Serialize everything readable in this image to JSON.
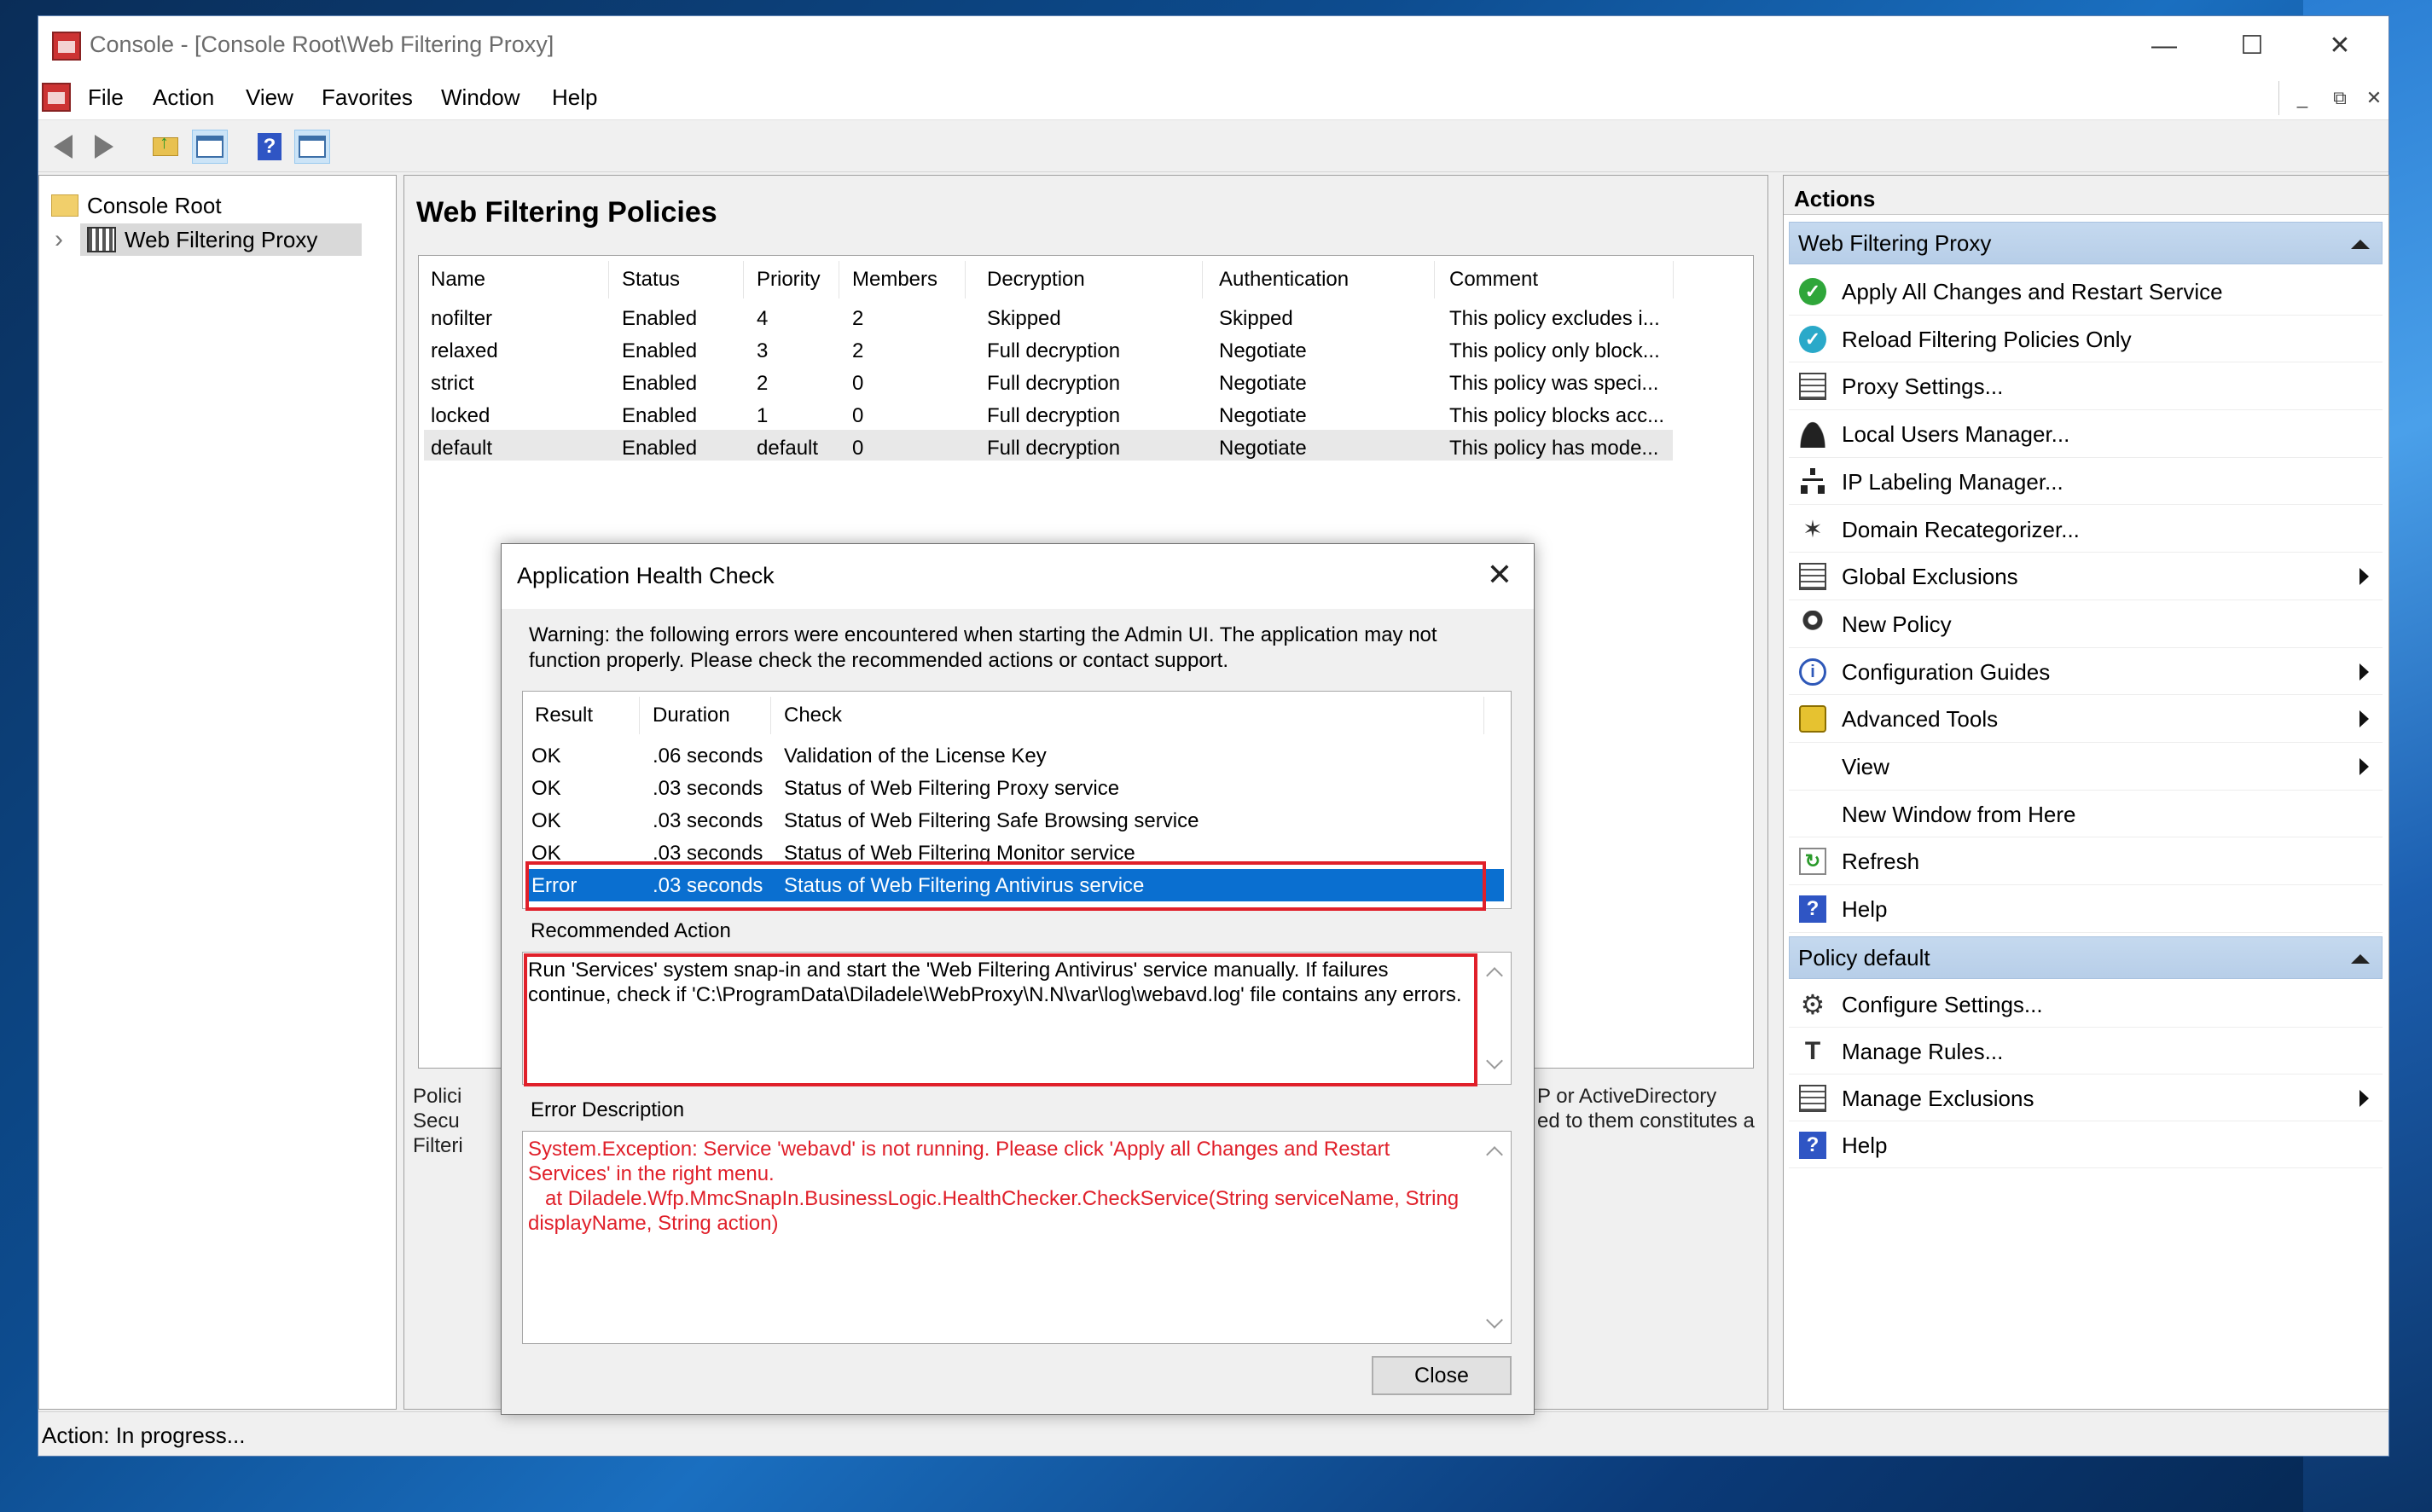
{
  "window": {
    "title": "Console - [Console Root\\Web Filtering Proxy]",
    "caption": {
      "minimize": "—",
      "maximize": "☐",
      "close": "✕"
    }
  },
  "menu": {
    "items": [
      "File",
      "Action",
      "View",
      "Favorites",
      "Window",
      "Help"
    ],
    "mdi": {
      "minimize": "_",
      "restore": "⧉",
      "close": "✕"
    }
  },
  "tree": {
    "root": "Console Root",
    "child": "Web Filtering Proxy",
    "expander": "›"
  },
  "policies": {
    "heading": "Web Filtering Policies",
    "columns": [
      "Name",
      "Status",
      "Priority",
      "Members",
      "Decryption",
      "Authentication",
      "Comment"
    ],
    "rows": [
      [
        "nofilter",
        "Enabled",
        "4",
        "2",
        "Skipped",
        "Skipped",
        "This policy excludes i..."
      ],
      [
        "relaxed",
        "Enabled",
        "3",
        "2",
        "Full decryption",
        "Negotiate",
        "This policy only block..."
      ],
      [
        "strict",
        "Enabled",
        "2",
        "0",
        "Full decryption",
        "Negotiate",
        "This policy was speci..."
      ],
      [
        "locked",
        "Enabled",
        "1",
        "0",
        "Full decryption",
        "Negotiate",
        "This policy blocks acc..."
      ],
      [
        "default",
        "Enabled",
        "default",
        "0",
        "Full decryption",
        "Negotiate",
        "This policy has mode..."
      ]
    ],
    "behind_left": [
      "Polici",
      "Secu",
      "Filteri"
    ],
    "behind_right": [
      "P or ActiveDirectory",
      "ed to them constitutes a"
    ]
  },
  "actions": {
    "title": "Actions",
    "group1": {
      "label": "Web Filtering Proxy",
      "items": [
        {
          "label": "Apply All Changes and Restart Service",
          "icon": "check-icon",
          "sub": false
        },
        {
          "label": "Reload Filtering Policies Only",
          "icon": "reload-icon",
          "sub": false
        },
        {
          "label": "Proxy Settings...",
          "icon": "settings-sheet-icon",
          "sub": false
        },
        {
          "label": "Local Users Manager...",
          "icon": "user-icon",
          "sub": false
        },
        {
          "label": "IP Labeling Manager...",
          "icon": "network-icon",
          "sub": false
        },
        {
          "label": "Domain Recategorizer...",
          "icon": "pin-icon",
          "sub": false
        },
        {
          "label": "Global Exclusions",
          "icon": "list-icon",
          "sub": true
        },
        {
          "label": "New Policy",
          "icon": "ribbon-icon",
          "sub": false
        },
        {
          "label": "Configuration Guides",
          "icon": "info-icon",
          "sub": true
        },
        {
          "label": "Advanced Tools",
          "icon": "lock-icon",
          "sub": true
        },
        {
          "label": "View",
          "icon": "",
          "sub": true
        },
        {
          "label": "New Window from Here",
          "icon": "",
          "sub": false
        },
        {
          "label": "Refresh",
          "icon": "refresh-icon",
          "sub": false
        },
        {
          "label": "Help",
          "icon": "help-icon",
          "sub": false
        }
      ]
    },
    "group2": {
      "label": "Policy default",
      "items": [
        {
          "label": "Configure Settings...",
          "icon": "gear-icon",
          "sub": false
        },
        {
          "label": "Manage Rules...",
          "icon": "hammer-icon",
          "sub": false
        },
        {
          "label": "Manage Exclusions",
          "icon": "list-icon",
          "sub": true
        },
        {
          "label": "Help",
          "icon": "help-icon",
          "sub": false
        }
      ]
    }
  },
  "status_bar": "Action:  In progress...",
  "dialog": {
    "title": "Application Health Check",
    "close_glyph": "✕",
    "warning": "Warning: the following errors were encountered when starting the Admin UI. The application may not function properly. Please check the recommended actions or contact support.",
    "columns": [
      "Result",
      "Duration",
      "Check"
    ],
    "rows": [
      [
        "OK",
        ".06 seconds",
        "Validation of the License Key"
      ],
      [
        "OK",
        ".03 seconds",
        "Status of Web Filtering Proxy service"
      ],
      [
        "OK",
        ".03 seconds",
        "Status of Web Filtering Safe Browsing service"
      ],
      [
        "OK",
        ".03 seconds",
        "Status of Web Filtering Monitor service"
      ],
      [
        "Error",
        ".03 seconds",
        "Status of Web Filtering Antivirus service"
      ]
    ],
    "selected_row": 4,
    "recommended_label": "Recommended Action",
    "recommended_text": "Run 'Services' system snap-in and start the 'Web Filtering Antivirus' service manually. If failures continue, check if 'C:\\ProgramData\\Diladele\\WebProxy\\N.N\\var\\log\\webavd.log' file contains any errors.",
    "error_label": "Error Description",
    "error_text": "System.Exception: Service 'webavd' is not running. Please click 'Apply all Changes and Restart Services' in the right menu.\n   at Diladele.Wfp.MmcSnapIn.BusinessLogic.HealthChecker.CheckService(String serviceName, String displayName, String action)",
    "close_button": "Close"
  },
  "colors": {
    "error_text": "#e0202a",
    "highlight_box": "#e0202a",
    "selection": "#0a6fd0",
    "group_header": "#c5d9ef"
  }
}
